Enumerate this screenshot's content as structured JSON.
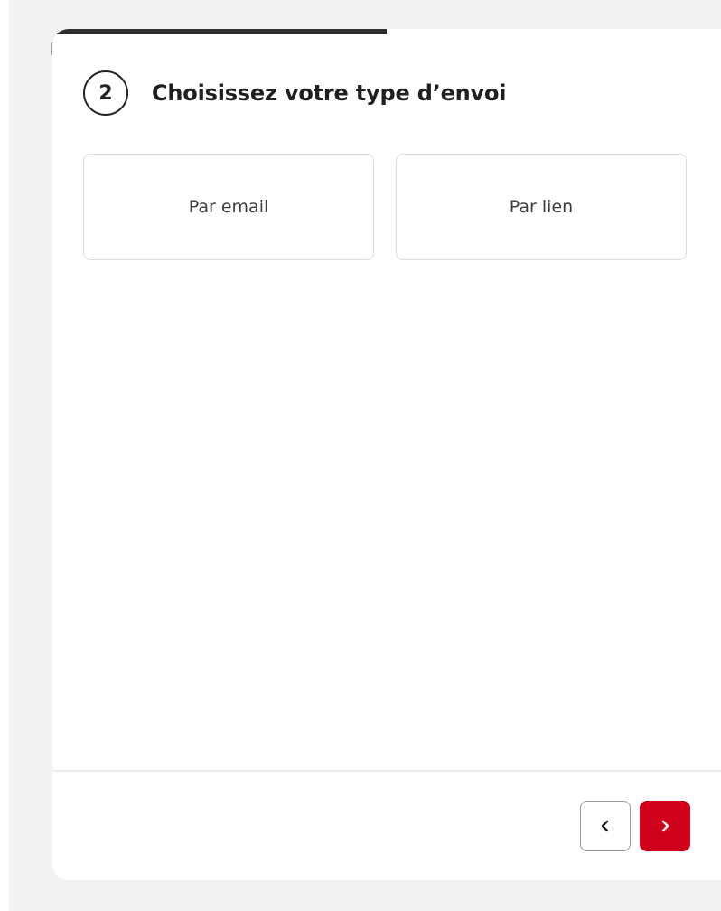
{
  "progress": {
    "fraction": 0.5,
    "color": "#2f2f2f"
  },
  "step": {
    "number": "2",
    "title": "Choisissez votre type d’envoi"
  },
  "options": [
    {
      "label": "Par email"
    },
    {
      "label": "Par lien"
    }
  ],
  "navigation": {
    "prev_icon": "chevron-left-icon",
    "next_icon": "chevron-right-icon",
    "next_color": "#d0021b"
  },
  "colors": {
    "accent": "#d0021b",
    "text": "#1f1f1f",
    "border": "#dcdcdc",
    "background": "#f2f2f2"
  }
}
